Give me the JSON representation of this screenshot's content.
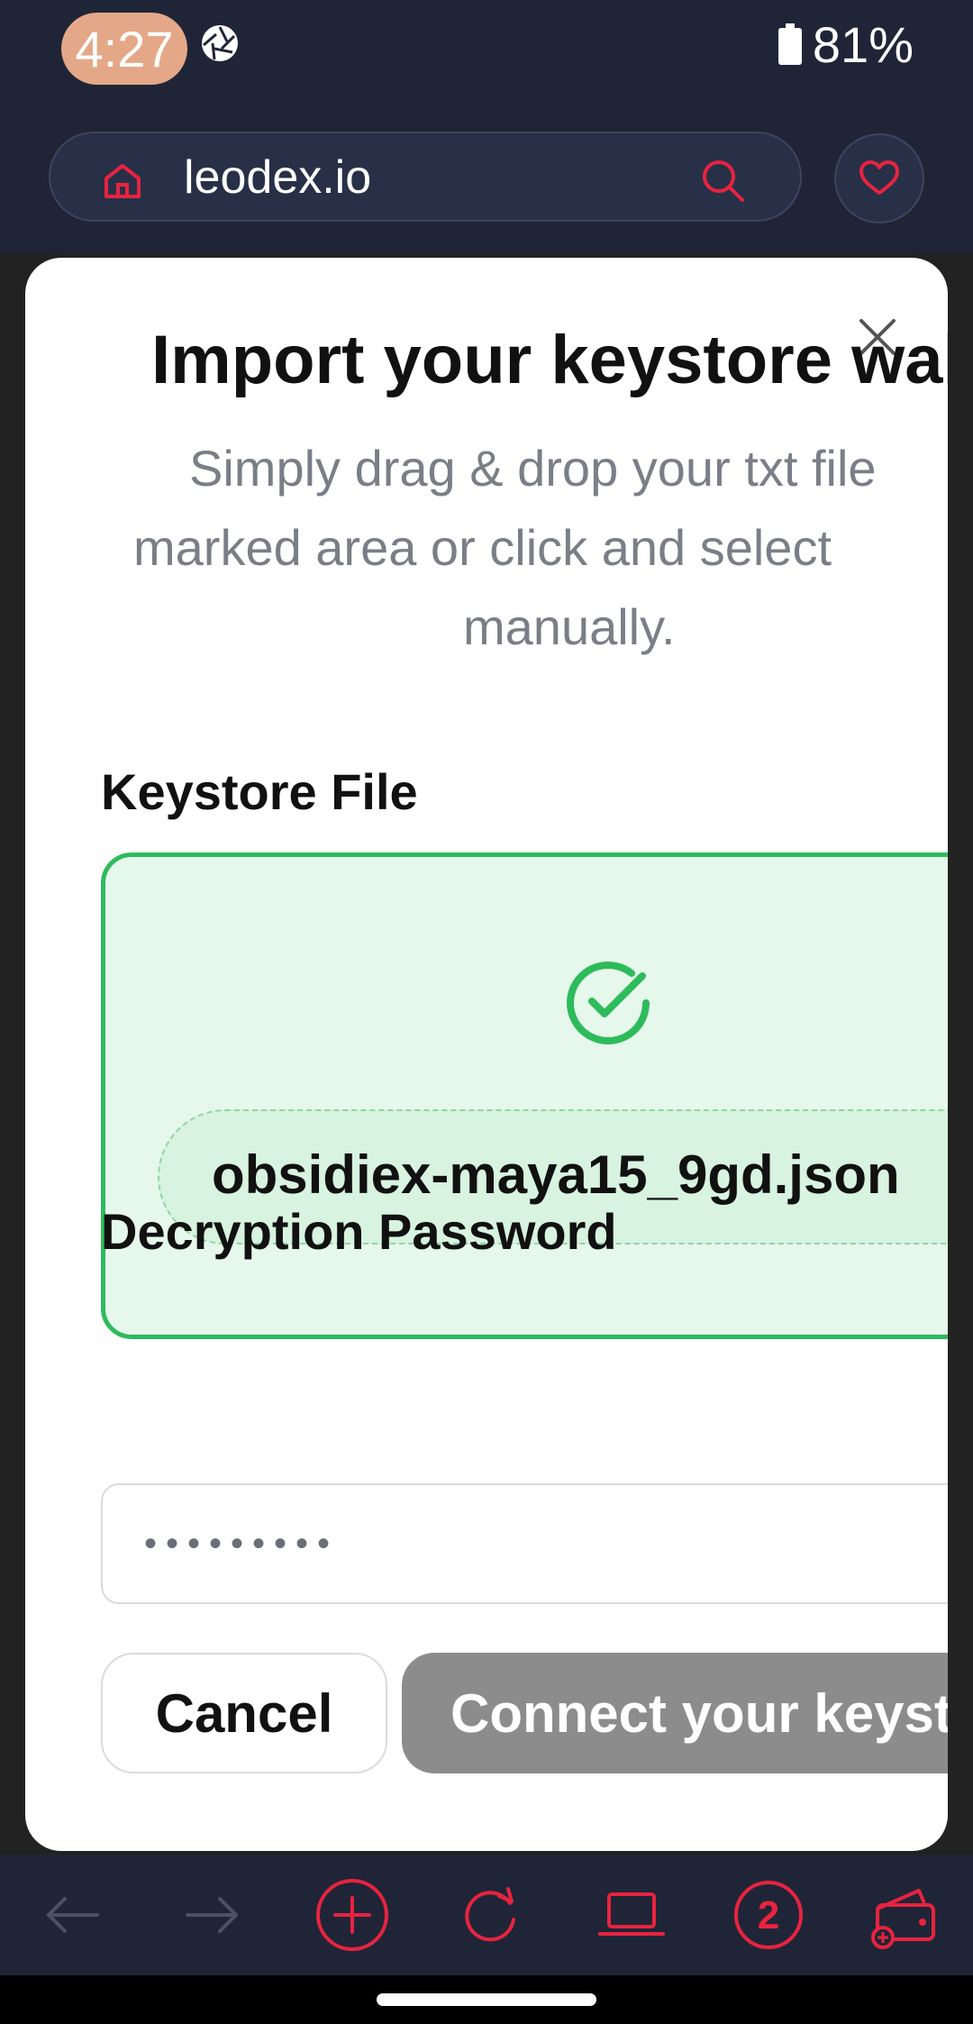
{
  "status_bar": {
    "time": "4:27",
    "battery": "81%"
  },
  "browser": {
    "url": "leodex.io",
    "accent_color": "#e8233f"
  },
  "modal": {
    "title": "Import your keystore wal",
    "description_lines": [
      "Simply drag & drop your txt file",
      "marked area or click and select",
      "manually."
    ],
    "keystore_label": "Keystore File",
    "file_name": "obsidiex-maya15_9gd.json",
    "password_label": "Decryption Password",
    "password_value": "•••••••••",
    "cancel_label": "Cancel",
    "connect_label": "Connect your keyst",
    "success_color": "#2ebb5c"
  },
  "toolbar": {
    "tab_count": "2"
  }
}
